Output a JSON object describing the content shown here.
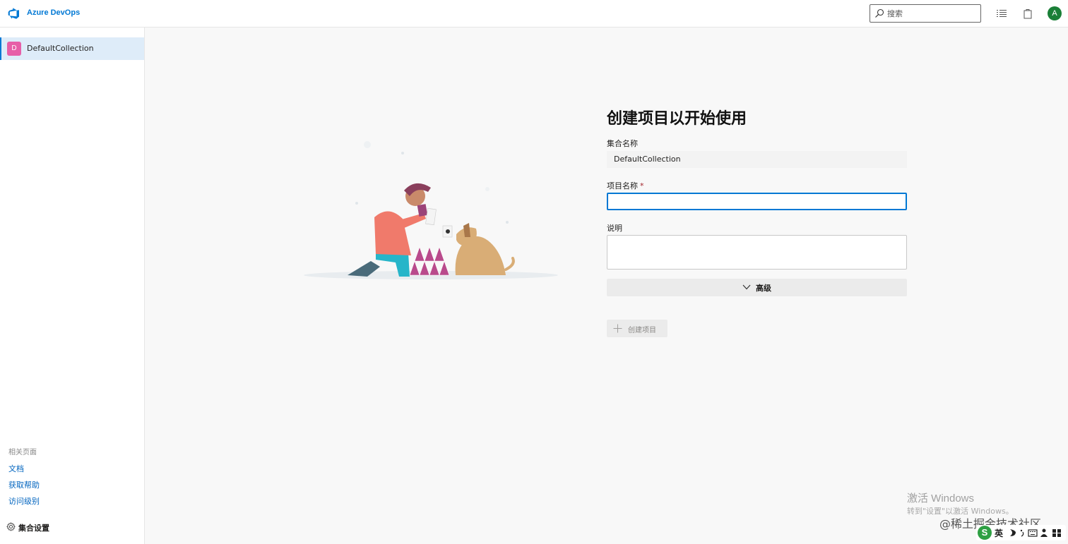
{
  "header": {
    "brand": "Azure DevOps",
    "search_placeholder": "搜索",
    "avatar_initial": "A"
  },
  "sidebar": {
    "organization": {
      "badge": "D",
      "name": "DefaultCollection"
    },
    "related_title": "相关页面",
    "links": [
      {
        "label": "文档"
      },
      {
        "label": "获取帮助"
      },
      {
        "label": "访问级别"
      }
    ],
    "settings_label": "集合设置"
  },
  "main": {
    "title": "创建项目以开始使用",
    "collection_label": "集合名称",
    "collection_value": "DefaultCollection",
    "project_name_label": "项目名称",
    "required_marker": "*",
    "project_name_value": "",
    "description_label": "说明",
    "description_value": "",
    "advanced_label": "高级",
    "create_label": "创建项目"
  },
  "overlay": {
    "activate_title": "激活 Windows",
    "activate_sub": "转到\"设置\"以激活 Windows。",
    "watermark": "@稀土掘金技术社区",
    "ime_logo": "S",
    "ime_lang": "英"
  },
  "colors": {
    "accent": "#0078d4",
    "selected_bg": "#deecf9",
    "org_badge": "#e75fa8",
    "avatar": "#1a7f37",
    "link": "#0064bf",
    "required": "#a4262c"
  }
}
